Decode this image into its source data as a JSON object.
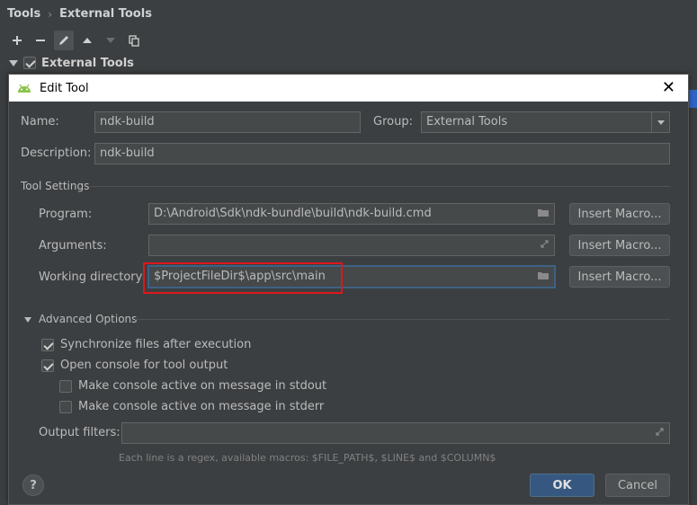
{
  "background": {
    "breadcrumb": [
      "Tools",
      "External Tools"
    ],
    "toolbar": {
      "add_icon": "plus-icon",
      "remove_icon": "minus-icon",
      "edit_icon": "pencil-icon",
      "up_icon": "arrow-up-icon",
      "down_icon": "arrow-down-icon",
      "copy_icon": "copy-icon"
    },
    "tree": {
      "group_label": "External Tools",
      "checked": true
    }
  },
  "dialog": {
    "title": "Edit Tool",
    "name": {
      "label": "Name:",
      "value": "ndk-build"
    },
    "group": {
      "label": "Group:",
      "value": "External Tools"
    },
    "description": {
      "label": "Description:",
      "value": "ndk-build"
    },
    "tool_settings": {
      "title": "Tool Settings",
      "program": {
        "label": "Program:",
        "value": "D:\\Android\\Sdk\\ndk-bundle\\build\\ndk-build.cmd"
      },
      "arguments": {
        "label": "Arguments:",
        "value": ""
      },
      "working_directory": {
        "label": "Working directory:",
        "value": "$ProjectFileDir$\\app\\src\\main"
      },
      "insert_macro_label": "Insert Macro..."
    },
    "advanced": {
      "title": "Advanced Options",
      "sync_files": {
        "label": "Synchronize files after execution",
        "checked": true
      },
      "open_console": {
        "label": "Open console for tool output",
        "checked": true
      },
      "console_stdout": {
        "label": "Make console active on message in stdout",
        "checked": false
      },
      "console_stderr": {
        "label": "Make console active on message in stderr",
        "checked": false
      },
      "output_filters": {
        "label": "Output filters:",
        "value": ""
      },
      "hint": "Each line is a regex, available macros: $FILE_PATH$, $LINE$ and $COLUMN$"
    },
    "buttons": {
      "ok": "OK",
      "cancel": "Cancel",
      "help": "?"
    }
  },
  "colors": {
    "accent": "#365880",
    "highlight_box": "#e0161b",
    "title_bar": "#ffffff"
  }
}
